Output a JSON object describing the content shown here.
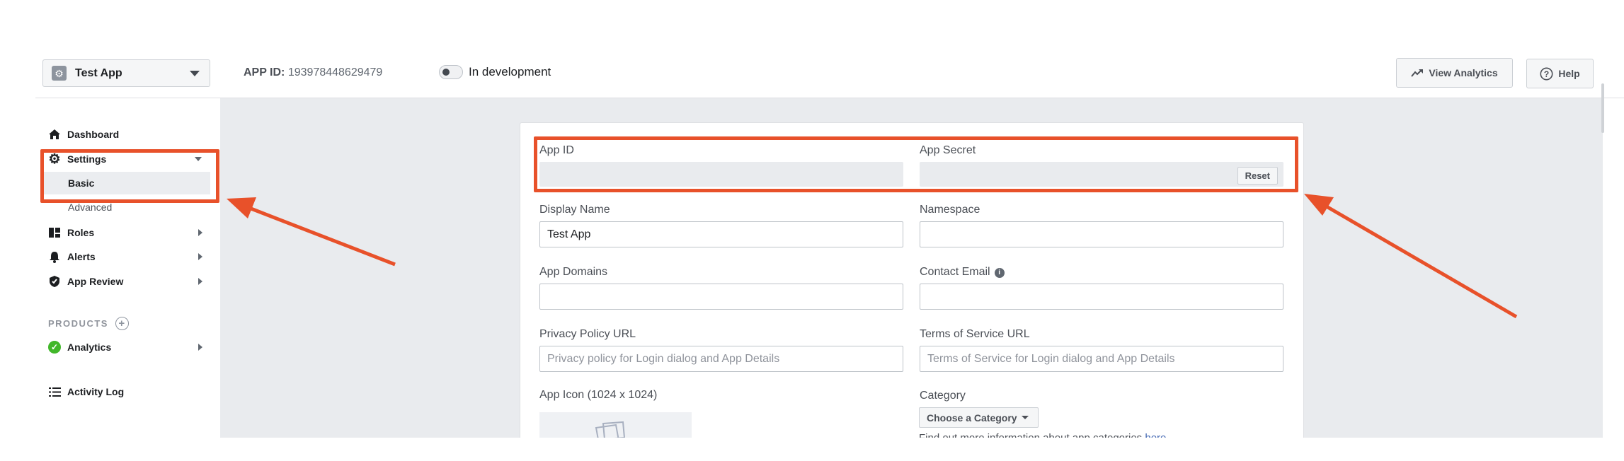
{
  "header": {
    "app_name": "Test App",
    "app_id_label": "APP ID:",
    "app_id_value": "193978448629479",
    "dev_mode_label": "In development",
    "view_analytics_label": "View Analytics",
    "help_label": "Help"
  },
  "sidebar": {
    "dashboard": "Dashboard",
    "settings": "Settings",
    "settings_basic": "Basic",
    "settings_advanced": "Advanced",
    "roles": "Roles",
    "alerts": "Alerts",
    "app_review": "App Review",
    "products_heading": "PRODUCTS",
    "analytics": "Analytics",
    "activity_log": "Activity Log"
  },
  "form": {
    "app_id_label": "App ID",
    "app_id_value": "",
    "app_secret_label": "App Secret",
    "app_secret_value": "",
    "reset_label": "Reset",
    "display_name_label": "Display Name",
    "display_name_value": "Test App",
    "namespace_label": "Namespace",
    "namespace_value": "",
    "app_domains_label": "App Domains",
    "app_domains_value": "",
    "contact_email_label": "Contact Email",
    "contact_email_value": "",
    "privacy_url_label": "Privacy Policy URL",
    "privacy_url_placeholder": "Privacy policy for Login dialog and App Details",
    "tos_url_label": "Terms of Service URL",
    "tos_url_placeholder": "Terms of Service for Login dialog and App Details",
    "app_icon_label": "App Icon (1024 x 1024)",
    "category_label": "Category",
    "category_button": "Choose a Category",
    "category_help_text": "Find out more information about app categories",
    "category_help_link": "here"
  },
  "colors": {
    "annotation": "#e8512a",
    "link": "#4267b2",
    "page_background": "#e9ebee",
    "success": "#42b72a"
  },
  "icons": {
    "app_badge": "gear-icon",
    "dashboard": "home-icon",
    "settings": "gear-icon",
    "roles": "roles-icon",
    "alerts": "bell-icon",
    "app_review": "shield-check-icon",
    "products_add": "plus-circle-icon",
    "analytics": "check-circle-icon",
    "activity_log": "list-icon",
    "view_analytics": "trend-up-icon",
    "help": "question-circle-icon",
    "contact_email_info": "info-icon"
  }
}
